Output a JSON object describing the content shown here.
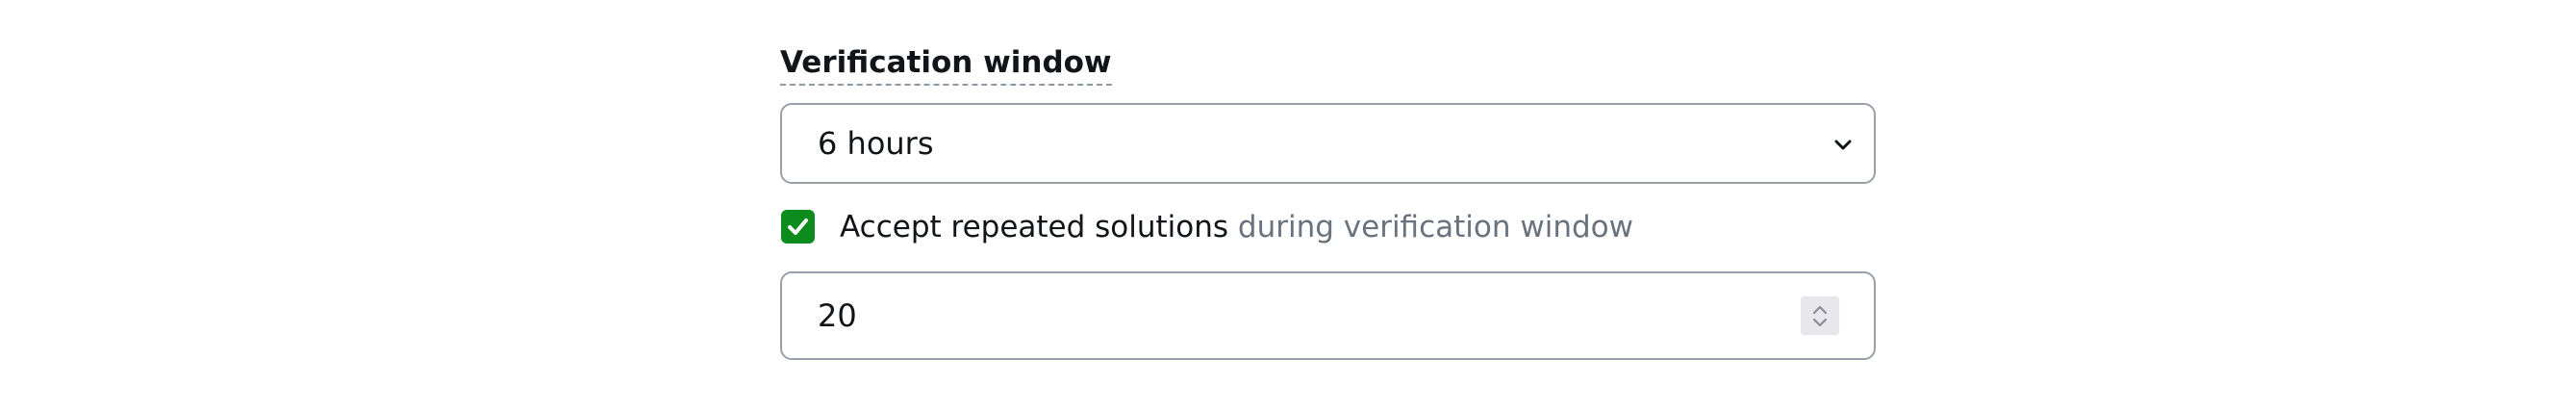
{
  "verification_window": {
    "label": "Verification window",
    "selected_value": "6 hours"
  },
  "repeated_solutions": {
    "checked": true,
    "label_main": "Accept repeated solutions",
    "label_secondary": " during verification window"
  },
  "repeat_limit": {
    "value": "20"
  },
  "colors": {
    "checkbox_checked": "#0b8c1c",
    "muted_text": "#6a727d",
    "border": "#9aa0a8"
  },
  "icons": {
    "select": "chevron-down-icon",
    "checkbox": "checkmark-icon",
    "stepper": "spin-button-icon"
  }
}
